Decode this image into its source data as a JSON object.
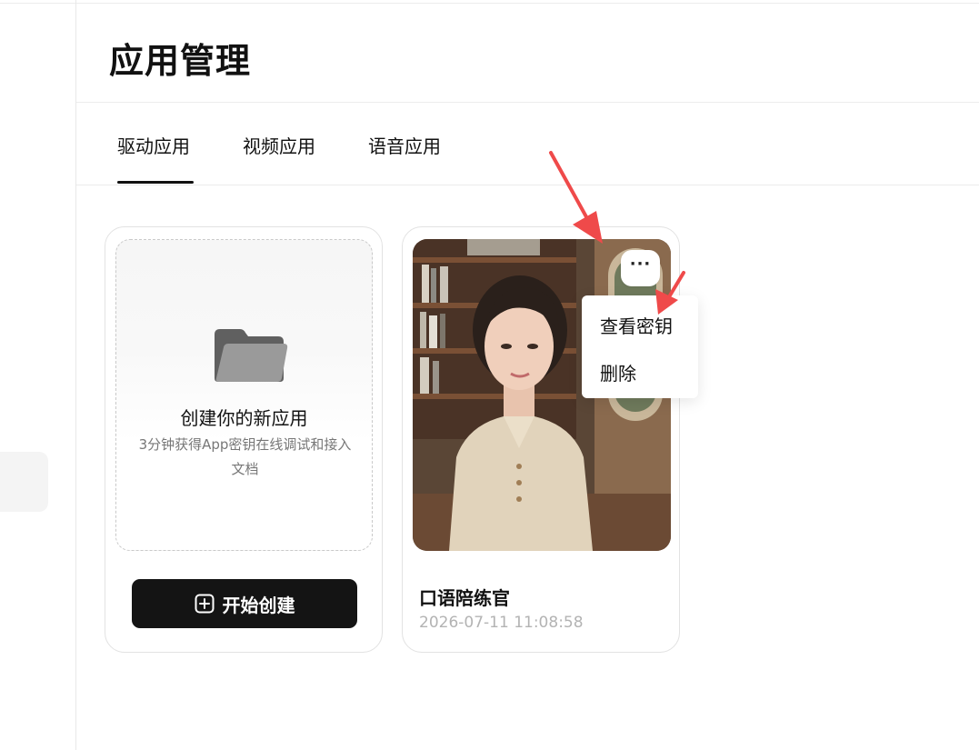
{
  "header": {
    "title": "应用管理"
  },
  "tabs": [
    {
      "label": "驱动应用",
      "active": true
    },
    {
      "label": "视频应用",
      "active": false
    },
    {
      "label": "语音应用",
      "active": false
    }
  ],
  "create_card": {
    "title": "创建你的新应用",
    "description": "3分钟获得App密钥在线调试和接入文档",
    "button_label": "开始创建"
  },
  "app_card": {
    "name": "口语陪练官",
    "date": "2026-07-11 11:08:58",
    "more_label": "···"
  },
  "menu": {
    "items": [
      {
        "label": "查看密钥"
      },
      {
        "label": "删除"
      }
    ]
  },
  "colors": {
    "accent": "#141414",
    "annotation_arrow": "#ef4a4a",
    "muted_text": "#b3b3b3"
  }
}
